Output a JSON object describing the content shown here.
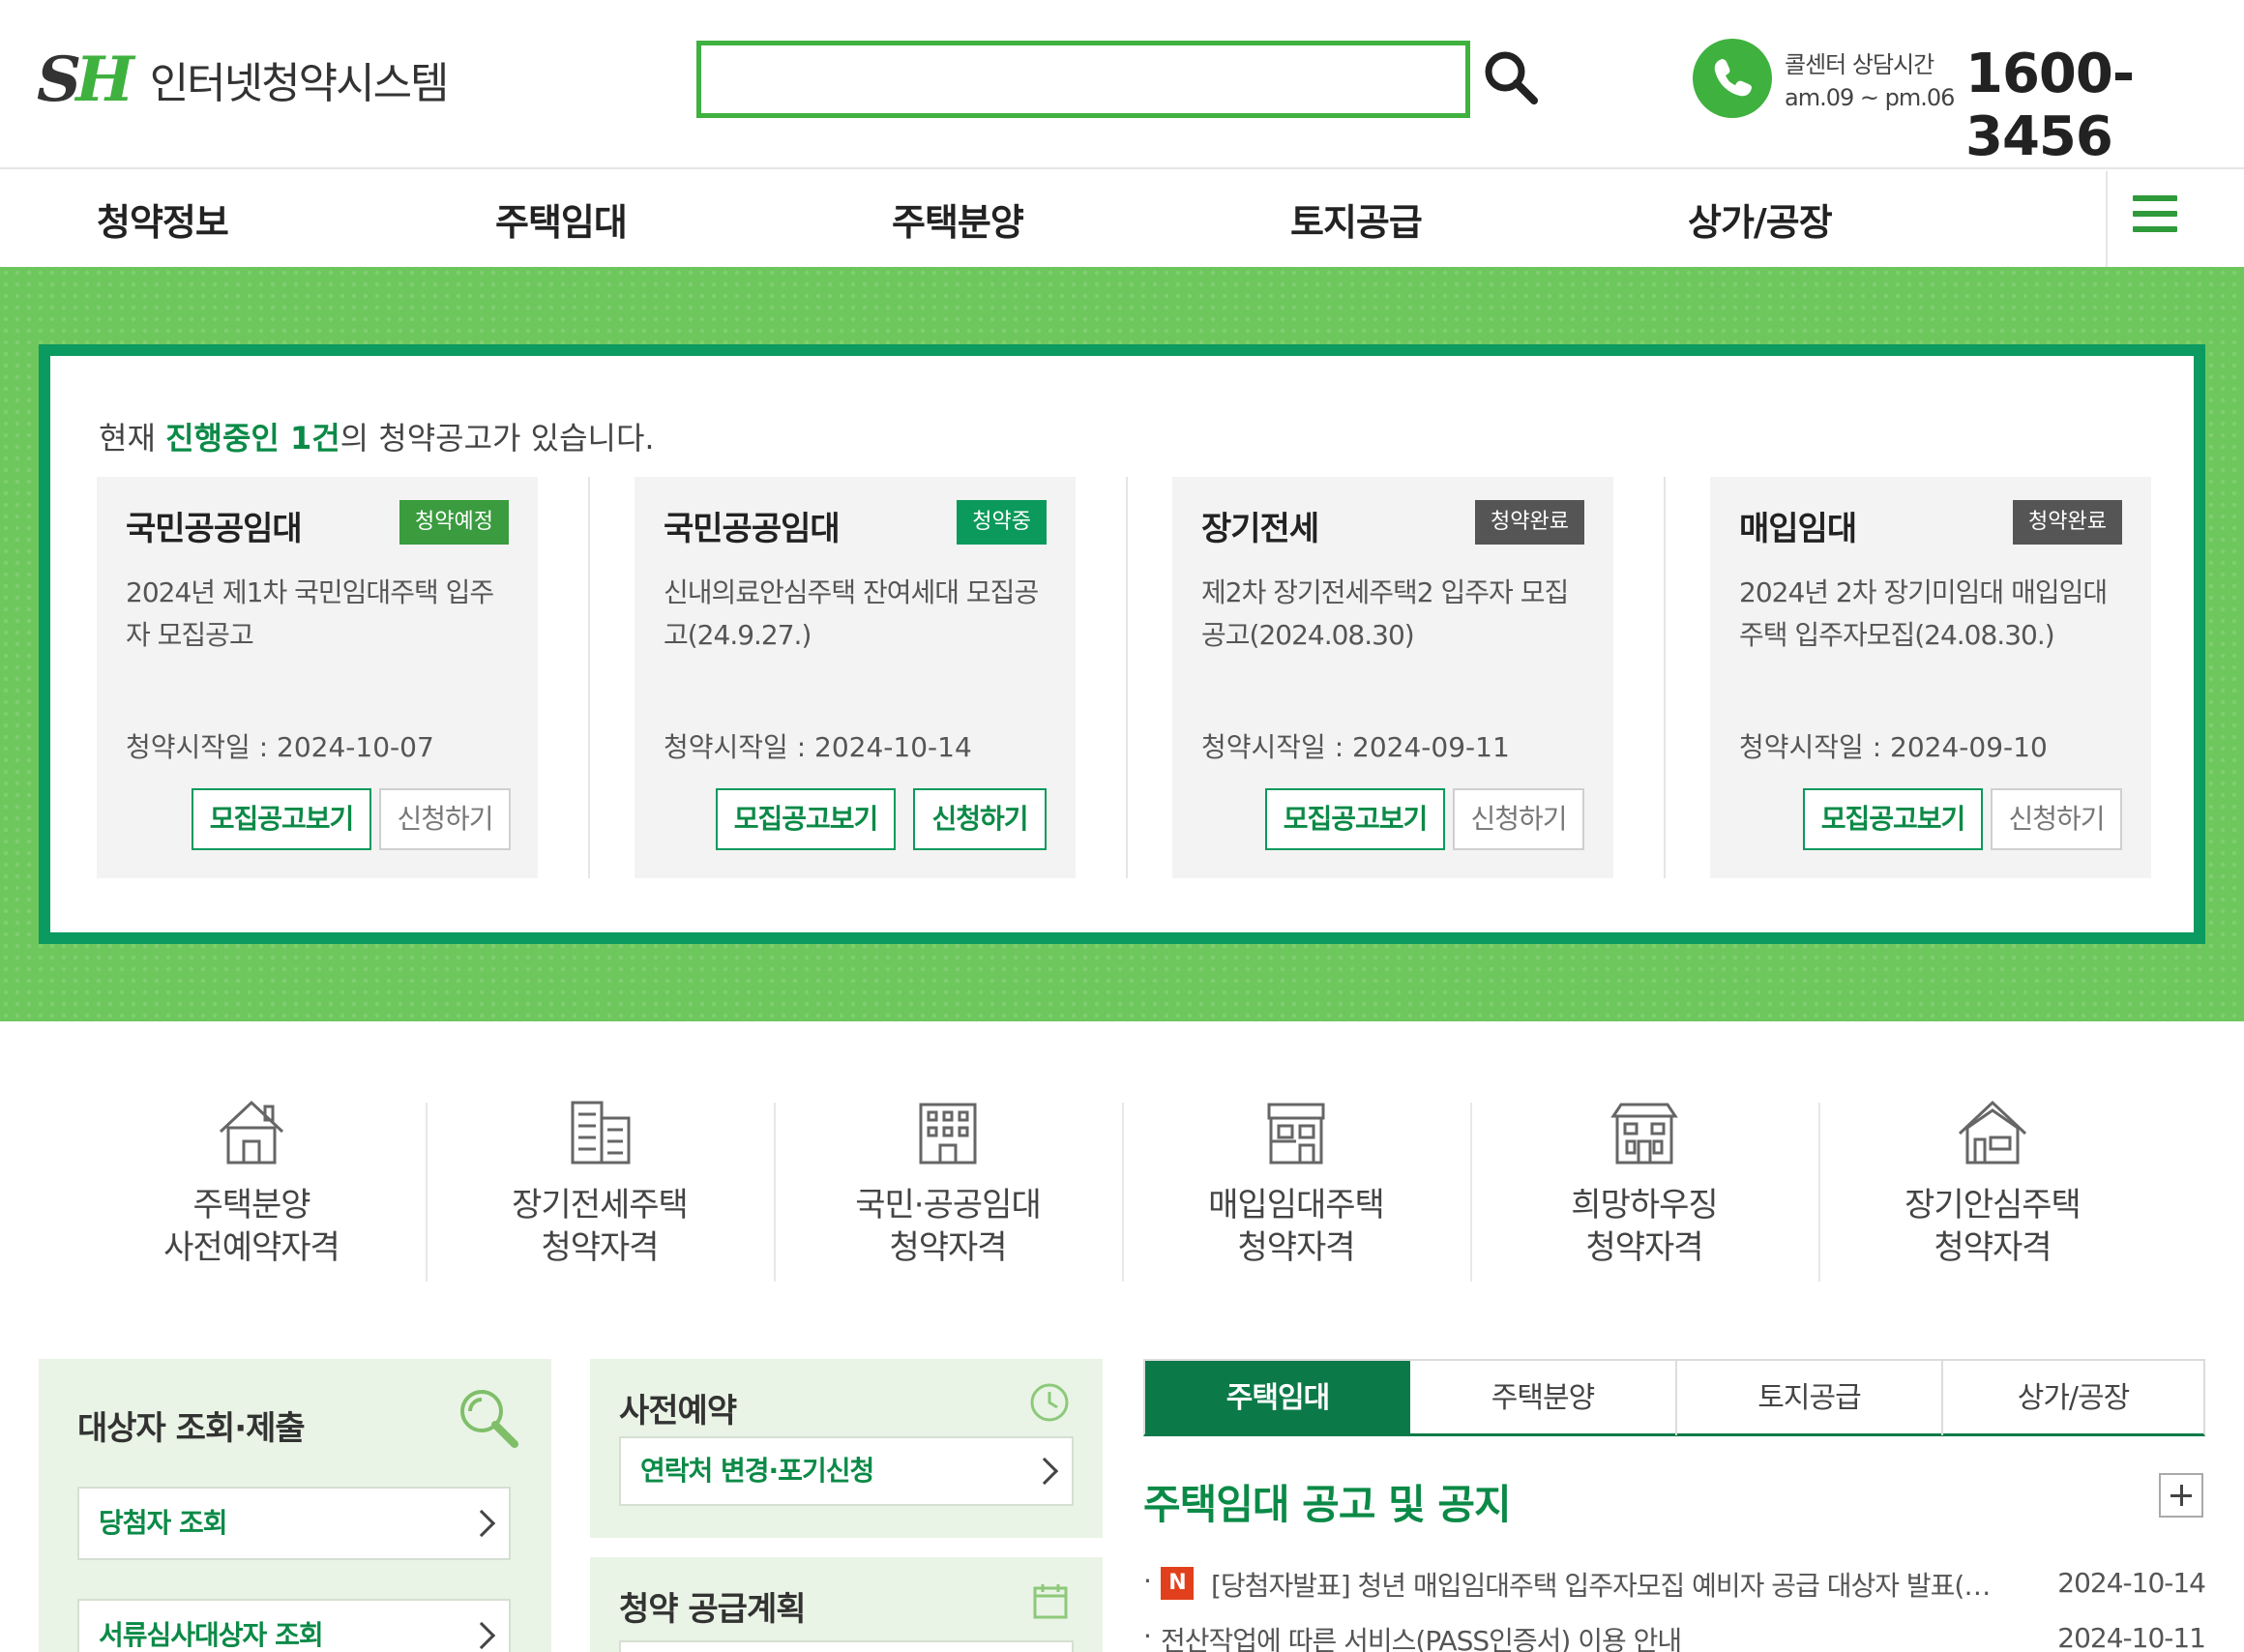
{
  "header": {
    "logo_mark_s": "S",
    "logo_mark_h": "H",
    "logo_text": "인터넷청약시스템",
    "search_value": "",
    "callcenter_label": "콜센터 상담시간",
    "callcenter_hours": "am.09 ~ pm.06",
    "phone": "1600-3456"
  },
  "nav": {
    "items": [
      "청약정보",
      "주택임대",
      "주택분양",
      "토지공급",
      "상가/공장"
    ]
  },
  "notice": {
    "prefix": "현재 ",
    "highlight": "진행중인 1건",
    "suffix": "의 청약공고가 있습니다."
  },
  "cards": [
    {
      "title": "국민공공임대",
      "badge": "청약예정",
      "desc": "2024년 제1차 국민임대주택 입주자 모집공고",
      "date": "청약시작일 : 2024-10-07",
      "btn_notice": "모집공고보기",
      "btn_apply": "신청하기"
    },
    {
      "title": "국민공공임대",
      "badge": "청약중",
      "desc": "신내의료안심주택 잔여세대 모집공고(24.9.27.)",
      "date": "청약시작일 : 2024-10-14",
      "btn_notice": "모집공고보기",
      "btn_apply": "신청하기"
    },
    {
      "title": "장기전세",
      "badge": "청약완료",
      "desc": "제2차 장기전세주택2 입주자 모집공고(2024.08.30)",
      "date": "청약시작일 : 2024-09-11",
      "btn_notice": "모집공고보기",
      "btn_apply": "신청하기"
    },
    {
      "title": "매입임대",
      "badge": "청약완료",
      "desc": "2024년 2차 장기미임대 매입임대주택 입주자모집(24.08.30.)",
      "date": "청약시작일 : 2024-09-10",
      "btn_notice": "모집공고보기",
      "btn_apply": "신청하기"
    }
  ],
  "quick_links": [
    {
      "line1": "주택분양",
      "line2": "사전예약자격",
      "icon": "house-icon"
    },
    {
      "line1": "장기전세주택",
      "line2": "청약자격",
      "icon": "apartment-icon"
    },
    {
      "line1": "국민·공공임대",
      "line2": "청약자격",
      "icon": "building-icon"
    },
    {
      "line1": "매입임대주택",
      "line2": "청약자격",
      "icon": "townhouse-icon"
    },
    {
      "line1": "희망하우징",
      "line2": "청약자격",
      "icon": "dormitory-icon"
    },
    {
      "line1": "장기안심주택",
      "line2": "청약자격",
      "icon": "home-icon"
    }
  ],
  "lookup_box": {
    "title": "대상자 조회·제출",
    "link1": "당첨자 조회",
    "link2": "서류심사대상자 조회"
  },
  "prereserve_box": {
    "title": "사전예약",
    "link1": "연락처 변경·포기신청"
  },
  "supply_box": {
    "title": "청약 공급계획"
  },
  "tabs": [
    "주택임대",
    "주택분양",
    "토지공급",
    "상가/공장"
  ],
  "news": {
    "title": "주택임대 공고 및 공지",
    "items": [
      {
        "badge": "N",
        "text": "[당첨자발표] 청년 매입임대주택 입주자모집 예비자 공급 대상자 발표(…",
        "date": "2024-10-14"
      },
      {
        "badge": "",
        "text": "전산작업에 따른 서비스(PASS인증서) 이용 안내",
        "date": "2024-10-11"
      }
    ]
  },
  "colors": {
    "brand_green": "#3fb13f",
    "dark_green": "#0b7a48",
    "banner_green": "#6dc75c",
    "badge_upcoming": "#3a9b3f",
    "badge_active": "#0c9a5c",
    "badge_done": "#555555"
  }
}
